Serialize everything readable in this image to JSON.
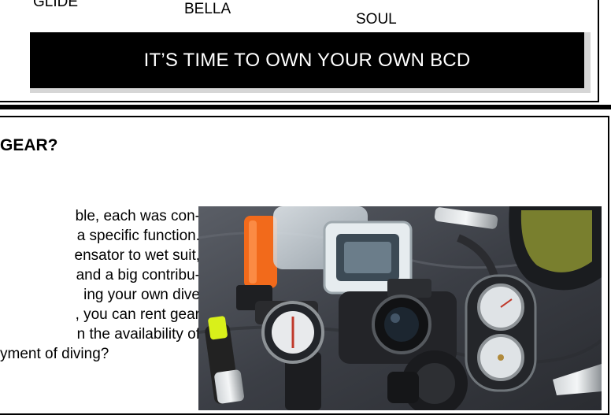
{
  "top_section": {
    "labels": [
      "GLIDE",
      "BELLA",
      "SOUL"
    ],
    "banner_text": "IT’S TIME TO OWN YOUR OWN BCD",
    "banner_bg": "#000000",
    "banner_fg": "#ffffff"
  },
  "article": {
    "heading": "GEAR?",
    "body_lines": [
      "ble, each was con-",
      "a specific function.",
      "ensator to wet suit,",
      "and a big contribu-",
      "ing your own dive",
      ", you can rent gear",
      "n the availability of",
      "yment of diving?"
    ],
    "image_subject": "scuba-gear-photo"
  }
}
